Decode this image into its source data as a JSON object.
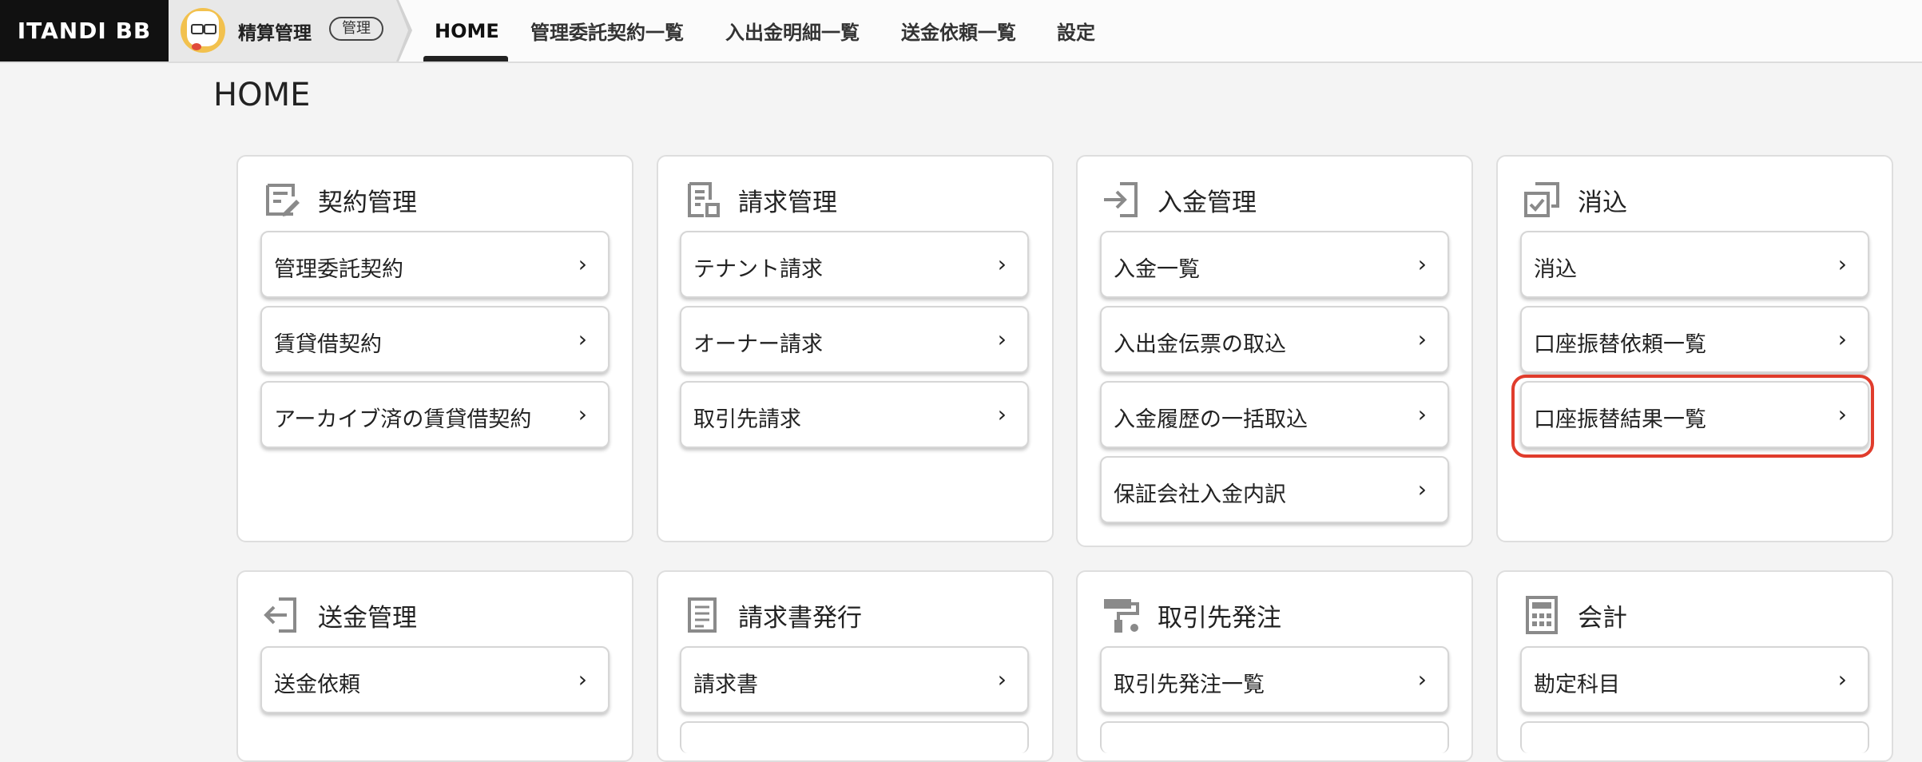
{
  "header": {
    "logo": "ITANDI BB",
    "app_name": "精算管理",
    "role_badge": "管理",
    "nav": [
      "HOME",
      "管理委託契約一覧",
      "入出金明細一覧",
      "送金依頼一覧",
      "設定"
    ],
    "active_nav": "HOME"
  },
  "page": {
    "title": "HOME"
  },
  "cards": [
    {
      "title": "契約管理",
      "icon": "contract-edit-icon",
      "items": [
        "管理委託契約",
        "賃貸借契約",
        "アーカイブ済の賃貸借契約"
      ]
    },
    {
      "title": "請求管理",
      "icon": "invoice-document-icon",
      "items": [
        "テナント請求",
        "オーナー請求",
        "取引先請求"
      ]
    },
    {
      "title": "入金管理",
      "icon": "login-arrow-icon",
      "items": [
        "入金一覧",
        "入出金伝票の取込",
        "入金履歴の一括取込",
        "保証会社入金内訳"
      ]
    },
    {
      "title": "消込",
      "icon": "check-copy-icon",
      "items": [
        "消込",
        "口座振替依頼一覧",
        "口座振替結果一覧"
      ]
    },
    {
      "title": "送金管理",
      "icon": "logout-arrow-icon",
      "items": [
        "送金依頼"
      ]
    },
    {
      "title": "請求書発行",
      "icon": "document-lines-icon",
      "items": [
        "請求書"
      ]
    },
    {
      "title": "取引先発注",
      "icon": "paint-roller-icon",
      "items": [
        "取引先発注一覧"
      ]
    },
    {
      "title": "会計",
      "icon": "calculator-icon",
      "items": [
        "勘定科目"
      ]
    }
  ],
  "chevron": "›",
  "colors": {
    "highlight": "#e03c2c",
    "logo_bg": "#111111"
  }
}
